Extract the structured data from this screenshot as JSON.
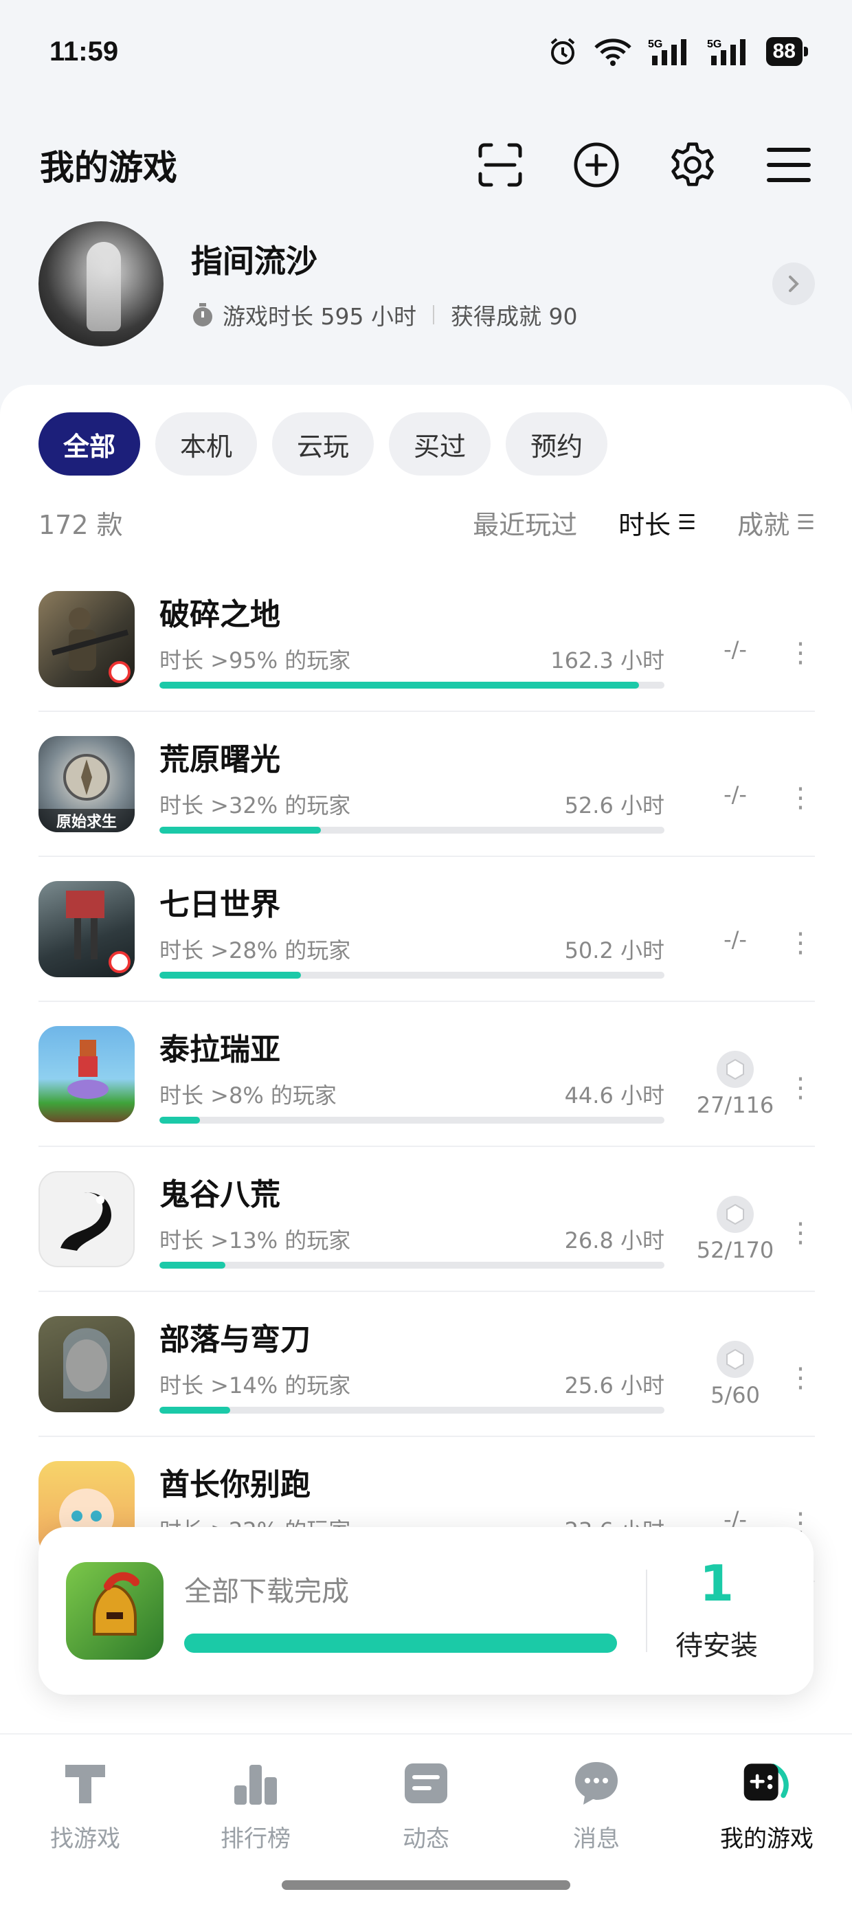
{
  "status_bar": {
    "time": "11:59",
    "battery": "88",
    "network_1": "5G",
    "network_2": "5G"
  },
  "header": {
    "title": "我的游戏"
  },
  "profile": {
    "name": "指间流沙",
    "play_time": "游戏时长 595 小时",
    "achievements": "获得成就 90"
  },
  "filters": [
    "全部",
    "本机",
    "云玩",
    "买过",
    "预约"
  ],
  "list_header": {
    "count": "172 款",
    "sort_recent": "最近玩过",
    "sort_time": "时长",
    "sort_achievement": "成就"
  },
  "games": [
    {
      "name": "破碎之地",
      "rank": "时长 >95% 的玩家",
      "hours": "162.3 小时",
      "progress": 95,
      "achievement": "-/-",
      "has_trophy": false
    },
    {
      "name": "荒原曙光",
      "rank": "时长 >32% 的玩家",
      "hours": "52.6 小时",
      "progress": 32,
      "achievement": "-/-",
      "has_trophy": false,
      "icon_caption": "原始求生"
    },
    {
      "name": "七日世界",
      "rank": "时长 >28% 的玩家",
      "hours": "50.2 小时",
      "progress": 28,
      "achievement": "-/-",
      "has_trophy": false
    },
    {
      "name": "泰拉瑞亚",
      "rank": "时长 >8% 的玩家",
      "hours": "44.6 小时",
      "progress": 8,
      "achievement": "27/116",
      "has_trophy": true
    },
    {
      "name": "鬼谷八荒",
      "rank": "时长 >13% 的玩家",
      "hours": "26.8 小时",
      "progress": 13,
      "achievement": "52/170",
      "has_trophy": true
    },
    {
      "name": "部落与弯刀",
      "rank": "时长 >14% 的玩家",
      "hours": "25.6 小时",
      "progress": 14,
      "achievement": "5/60",
      "has_trophy": true
    },
    {
      "name": "酋长你别跑",
      "rank": "时长 >22% 的玩家",
      "hours": "23.6 小时",
      "progress": 22,
      "achievement": "-/-",
      "has_trophy": false
    }
  ],
  "download": {
    "status": "全部下载完成",
    "progress": 100,
    "count": "1",
    "label": "待安装"
  },
  "bottom_nav": [
    {
      "label": "找游戏",
      "active": false
    },
    {
      "label": "排行榜",
      "active": false
    },
    {
      "label": "动态",
      "active": false
    },
    {
      "label": "消息",
      "active": false
    },
    {
      "label": "我的游戏",
      "active": true
    }
  ]
}
